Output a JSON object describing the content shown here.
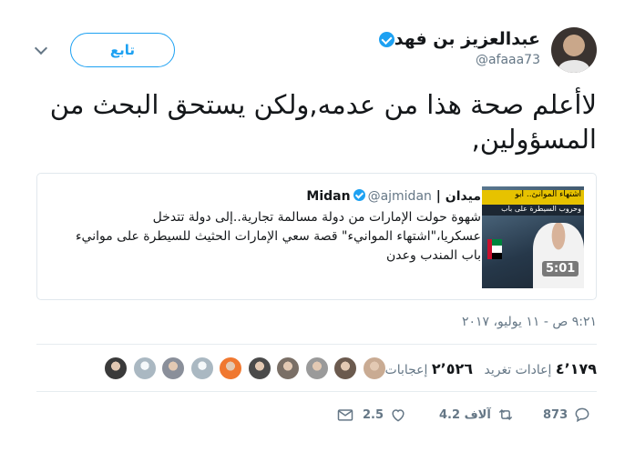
{
  "author": {
    "display_name": "عبدالعزيز بن فهد",
    "handle": "@afaaa73"
  },
  "follow_label": "تابع",
  "tweet_text": "لاأعلم صحة هذا من عدمه,ولكن يستحق البحث من المسؤولين,",
  "quoted_card": {
    "name": "ميدان | Midan",
    "handle": "@ajmidan",
    "text": "شهوة حولت الإمارات من دولة مسالمة تجارية..إلى دولة تتدخل عسكريا،\"اشتهاء الموانيء\" قصة سعي الإمارات الحثيث للسيطرة على موانيء باب المندب وعدن",
    "thumb_title": "اشتهاء الموانئ.. أبو",
    "thumb_subtitle": "وحروب السيطرة على باب",
    "video_duration": "5:01"
  },
  "timestamp": "٩:٢١ ص - ١١ يوليو، ٢٠١٧",
  "stats": {
    "retweets_count": "٤٬١٧٩",
    "retweets_label": "إعادات تغريد",
    "likes_count": "٢٬٥٢٦",
    "likes_label": "إعجابات"
  },
  "liker_avatars": [
    {
      "icon": "avatar-photo",
      "color": "#c9ab93"
    },
    {
      "icon": "avatar-photo",
      "color": "#6b5a4e"
    },
    {
      "icon": "avatar-photo",
      "color": "#9a9a9a"
    },
    {
      "icon": "avatar-photo",
      "color": "#7a6f66"
    },
    {
      "icon": "avatar-photo",
      "color": "#4a4a4a"
    },
    {
      "icon": "avatar-photo",
      "color": "#f07830"
    },
    {
      "icon": "avatar-default",
      "color": "#aab8c2"
    },
    {
      "icon": "avatar-photo",
      "color": "#8a8f9a"
    },
    {
      "icon": "avatar-default",
      "color": "#aab8c2"
    },
    {
      "icon": "avatar-photo",
      "color": "#3a3a3a"
    }
  ],
  "actions": {
    "reply_count": "873",
    "retweet_count": "4.2 آلاف",
    "like_count": "2.5",
    "dm_icon": "envelope-icon"
  },
  "colors": {
    "accent": "#1da1f2",
    "text": "#14171a",
    "muted": "#657786"
  }
}
